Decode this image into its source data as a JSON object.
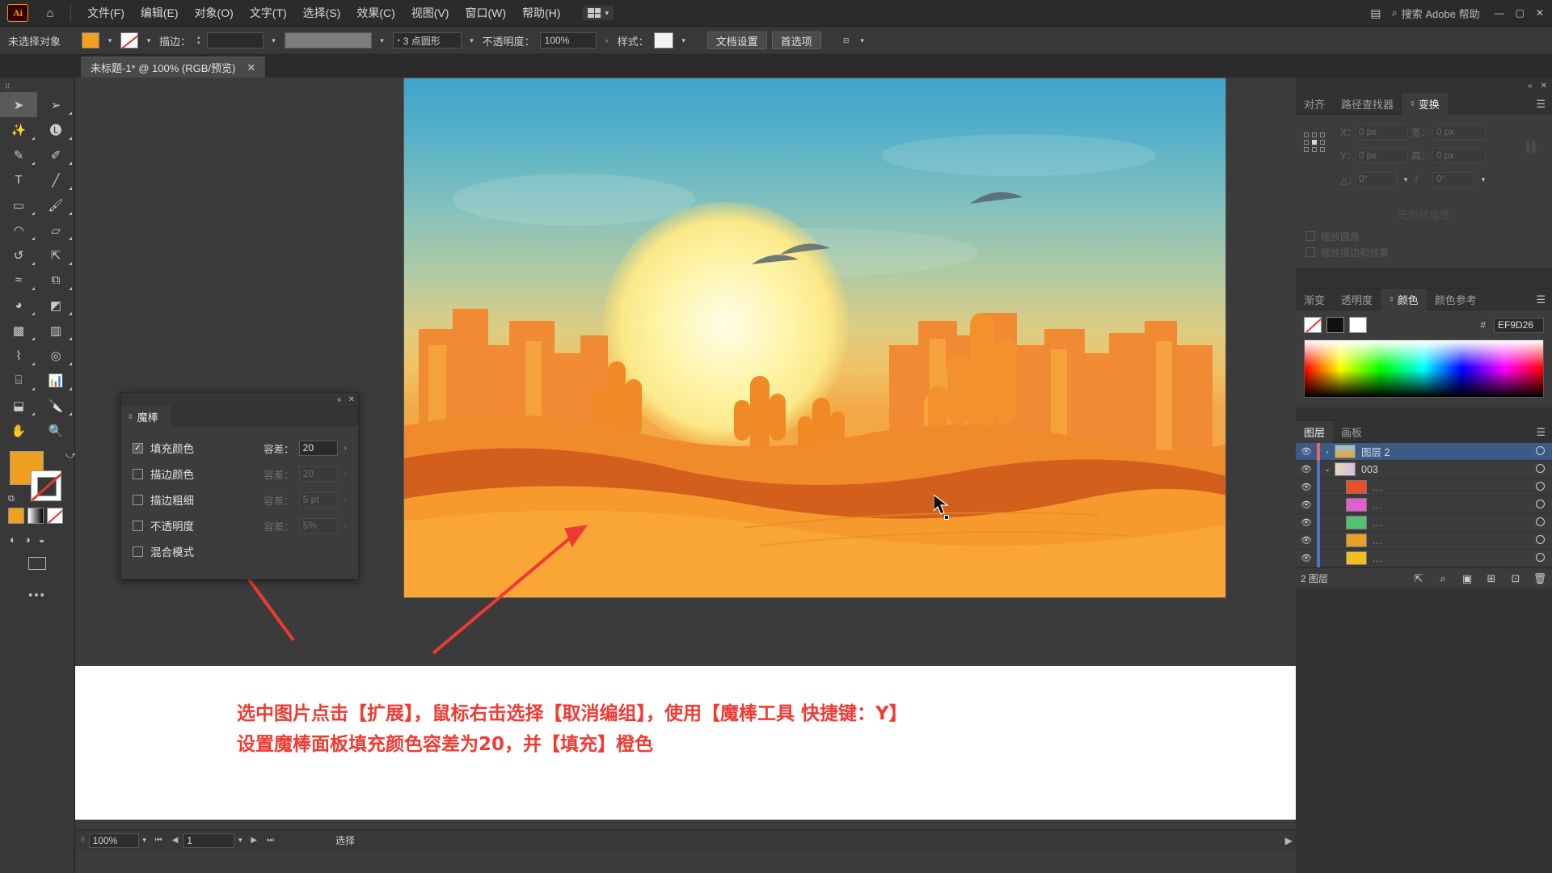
{
  "app": {
    "logo": "Ai",
    "home_icon": "home-icon"
  },
  "menubar": {
    "items": [
      "文件(F)",
      "编辑(E)",
      "对象(O)",
      "文字(T)",
      "选择(S)",
      "效果(C)",
      "视图(V)",
      "窗口(W)",
      "帮助(H)"
    ],
    "search_placeholder": "搜索 Adobe 帮助",
    "search_label": "搜索 Adobe 帮助"
  },
  "controlbar": {
    "selection_status": "未选择对象",
    "fill_color": "#F0A020",
    "stroke_label": "描边：",
    "stroke_weight": "",
    "profile": "3 点圆形",
    "opacity_label": "不透明度：",
    "opacity_value": "100%",
    "style_label": "样式：",
    "doc_setup_button": "文档设置",
    "preferences_button": "首选项"
  },
  "tabbar": {
    "document_title": "未标题-1* @ 100% (RGB/预览)",
    "close": "✕"
  },
  "toolbar": {
    "tools": [
      "selection-tool",
      "direct-selection-tool",
      "magic-wand-tool",
      "lasso-tool",
      "pen-tool",
      "curvature-tool",
      "type-tool",
      "line-segment-tool",
      "rectangle-tool",
      "paintbrush-tool",
      "shaper-tool",
      "eraser-tool",
      "rotate-tool",
      "scale-tool",
      "width-tool",
      "free-transform-tool",
      "shape-builder-tool",
      "perspective-grid-tool",
      "mesh-tool",
      "gradient-tool",
      "eyedropper-tool",
      "blend-tool",
      "symbol-sprayer-tool",
      "column-graph-tool",
      "artboard-tool",
      "slice-tool",
      "hand-tool",
      "zoom-tool"
    ],
    "fill_color": "#F0A020",
    "stroke_color": "none"
  },
  "wand_panel": {
    "title": "魔棒",
    "rows": [
      {
        "label": "填充颜色",
        "checked": true,
        "tol_label": "容差：",
        "tol_value": "20",
        "enabled": true
      },
      {
        "label": "描边颜色",
        "checked": false,
        "tol_label": "容差：",
        "tol_value": "20",
        "enabled": false
      },
      {
        "label": "描边粗细",
        "checked": false,
        "tol_label": "容差：",
        "tol_value": "5 pt",
        "enabled": false
      },
      {
        "label": "不透明度",
        "checked": false,
        "tol_label": "容差：",
        "tol_value": "5%",
        "enabled": false
      },
      {
        "label": "混合模式",
        "checked": false,
        "tol_label": "",
        "tol_value": "",
        "enabled": false
      }
    ]
  },
  "transform_panel": {
    "tabs": [
      {
        "label": "对齐",
        "active": false
      },
      {
        "label": "路径查找器",
        "active": false
      },
      {
        "label": "变换",
        "active": true
      }
    ],
    "fields": {
      "x_label": "X：",
      "x_value": "0 px",
      "y_label": "Y：",
      "y_value": "0 px",
      "w_label": "宽：",
      "w_value": "0 px",
      "h_label": "高：",
      "h_value": "0 px",
      "angle_label": "△：",
      "angle_value": "0°",
      "shear_label": "",
      "shear_value": "0°"
    },
    "no_properties": "无形状属性",
    "checkboxes": [
      "缩放圆角",
      "缩放描边和效果"
    ]
  },
  "color_panel": {
    "tabs": [
      {
        "label": "渐变",
        "active": false
      },
      {
        "label": "透明度",
        "active": false
      },
      {
        "label": "颜色",
        "active": true
      },
      {
        "label": "颜色参考",
        "active": false
      }
    ],
    "hash": "#",
    "hex_value": "EF9D26"
  },
  "layers_panel": {
    "tabs": [
      {
        "label": "图层",
        "active": true
      },
      {
        "label": "画板",
        "active": false
      }
    ],
    "rows": [
      {
        "name": "图层 2",
        "selected": true,
        "indent": 0,
        "has_arrow": true,
        "arrow": "›",
        "thumb": "#e8922e",
        "bar": "#e8675a"
      },
      {
        "name": "003",
        "selected": false,
        "indent": 0,
        "has_arrow": true,
        "arrow": "⌄",
        "thumb": "#d8d8c0",
        "bar": "#4b73c8"
      },
      {
        "name": "...",
        "selected": false,
        "indent": 1,
        "has_arrow": false,
        "arrow": "",
        "thumb": "#e8502a",
        "bar": "#4b73c8"
      },
      {
        "name": "...",
        "selected": false,
        "indent": 1,
        "has_arrow": false,
        "arrow": "",
        "thumb": "#e060d0",
        "bar": "#4b73c8"
      },
      {
        "name": "...",
        "selected": false,
        "indent": 1,
        "has_arrow": false,
        "arrow": "",
        "thumb": "#55c070",
        "bar": "#4b73c8"
      },
      {
        "name": "...",
        "selected": false,
        "indent": 1,
        "has_arrow": false,
        "arrow": "",
        "thumb": "#e8a028",
        "bar": "#4b73c8"
      },
      {
        "name": "...",
        "selected": false,
        "indent": 1,
        "has_arrow": false,
        "arrow": "",
        "thumb": "#f0c020",
        "bar": "#4b73c8"
      }
    ],
    "footer_count": "2 图层"
  },
  "statusbar": {
    "zoom": "100%",
    "page": "1",
    "status": "选择"
  },
  "caption": {
    "line1": "选中图片点击【扩展】，鼠标右击选择【取消编组】，使用【魔棒工具 快捷键：Y】",
    "line2": "设置魔棒面板填充颜色容差为20，并【填充】橙色",
    "color": "#EF3B33"
  },
  "artwork": {
    "alt": "desert sunset illustration with cacti, mesas and birds"
  }
}
